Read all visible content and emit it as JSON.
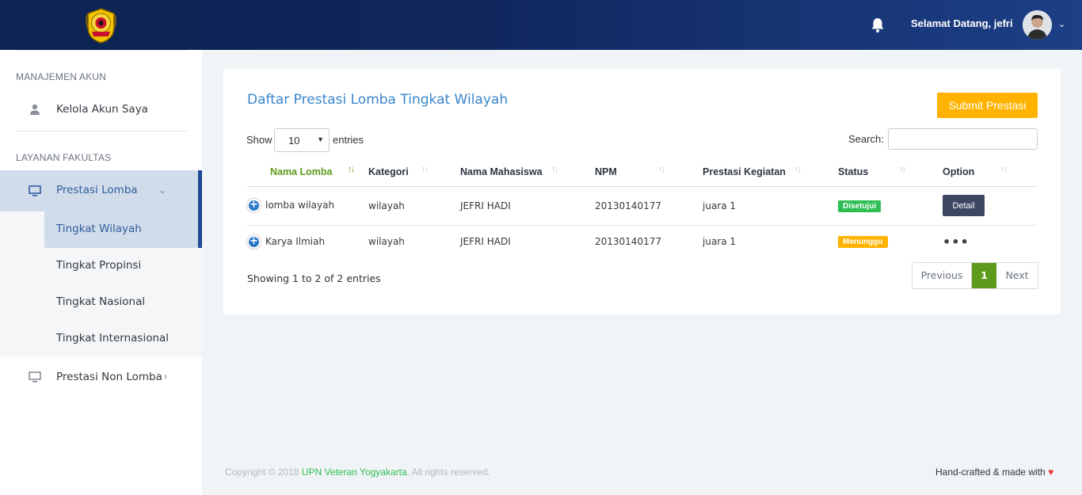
{
  "header": {
    "welcome": "Selamat Datang, jefri",
    "caret": "⌄"
  },
  "sidebar": {
    "section1": "MANAJEMEN AKUN",
    "item_akun": "Kelola Akun Saya",
    "section2": "LAYANAN FAKULTAS",
    "item_lomba": "Prestasi Lomba",
    "sub_wilayah": "Tingkat Wilayah",
    "sub_propinsi": "Tingkat Propinsi",
    "sub_nasional": "Tingkat Nasional",
    "sub_internasional": "Tingkat Internasional",
    "item_non_lomba": "Prestasi Non Lomba"
  },
  "card": {
    "title": "Daftar Prestasi Lomba Tingkat Wilayah",
    "submit_label": "Submit Prestasi",
    "show_label": "Show",
    "entries_label": "entries",
    "page_size": "10",
    "search_label": "Search:",
    "search_value": ""
  },
  "table": {
    "headers": [
      "Nama Lomba",
      "Kategori",
      "Nama Mahasiswa",
      "NPM",
      "Prestasi Kegiatan",
      "Status",
      "Option"
    ],
    "rows": [
      {
        "nama_lomba": "lomba wilayah",
        "kategori": "wilayah",
        "mahasiswa": "JEFRI HADI",
        "npm": "20130140177",
        "prestasi": "juara 1",
        "status": "Disetujui",
        "option": "Detail"
      },
      {
        "nama_lomba": "Karya Ilmiah",
        "kategori": "wilayah",
        "mahasiswa": "JEFRI HADI",
        "npm": "20130140177",
        "prestasi": "juara 1",
        "status": "Menunggu",
        "option": "•••"
      }
    ],
    "info": "Showing 1 to 2 of 2 entries",
    "prev": "Previous",
    "page": "1",
    "next": "Next"
  },
  "footer": {
    "copyright_pre": "Copyright © 2018 ",
    "copyright_link": "UPN Veteran Yogyakarta",
    "copyright_post": ". All rights reserved.",
    "made_with": "Hand-crafted & made with ",
    "heart": "♥"
  },
  "colors": {
    "accent": "#1e4a94",
    "title": "#3a85cc",
    "submit": "#ffb300",
    "approved": "#2fbe54",
    "pending": "#ffb300",
    "page_active": "#5d9b1c"
  }
}
